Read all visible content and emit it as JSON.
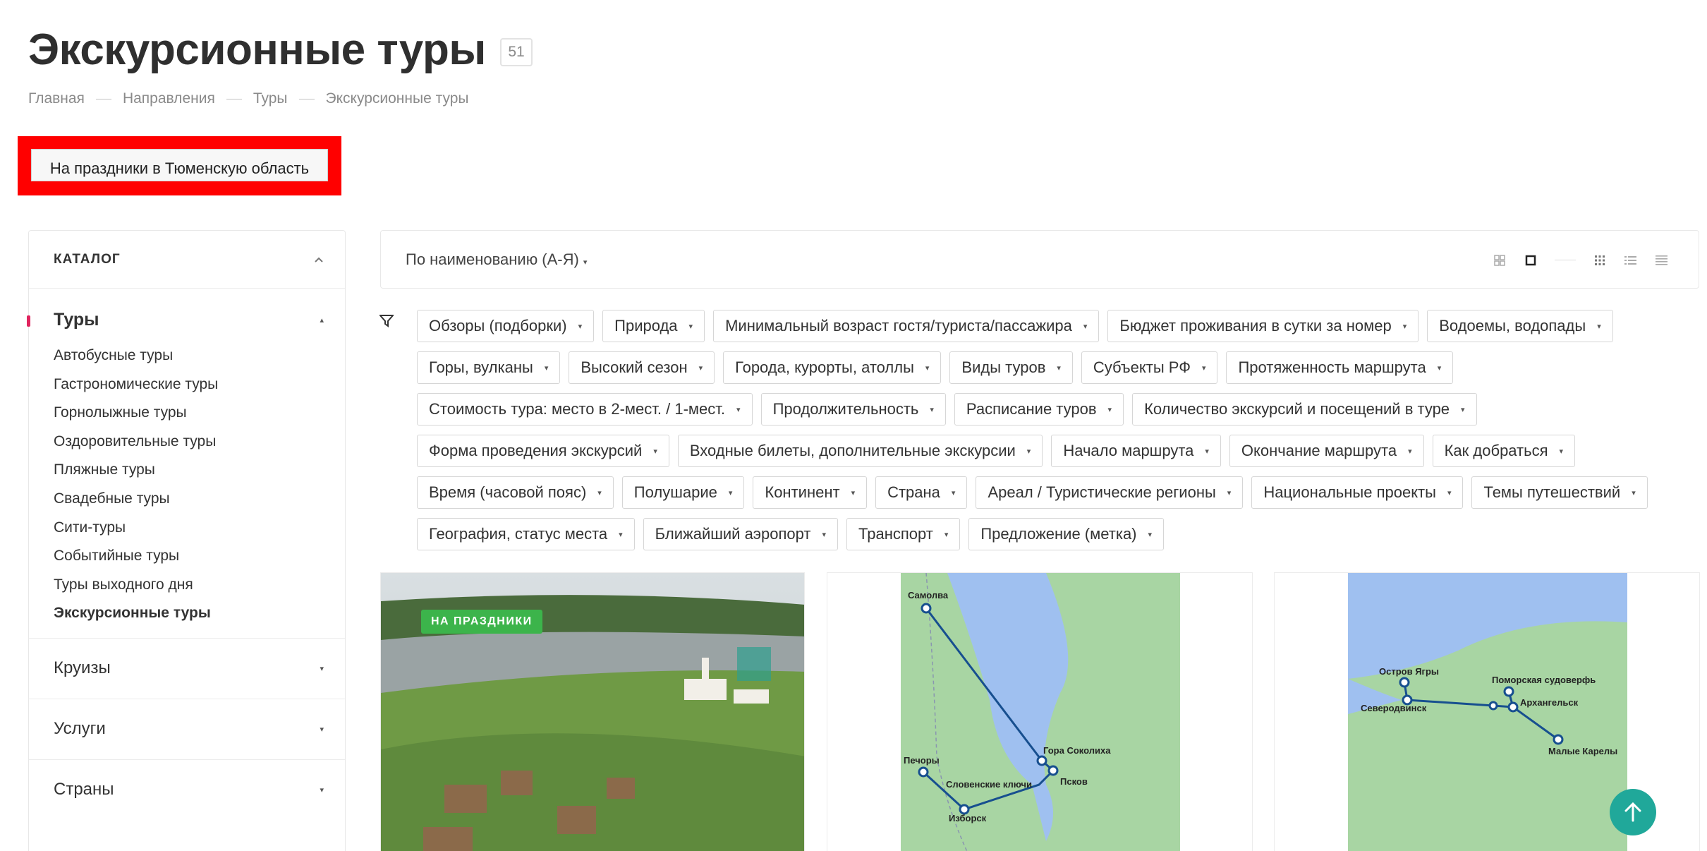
{
  "header": {
    "title": "Экскурсионные туры",
    "count": "51"
  },
  "breadcrumb": [
    "Главная",
    "Направления",
    "Туры",
    "Экскурсионные туры"
  ],
  "promo": {
    "label": "На праздники в Тюменскую область"
  },
  "sidebar": {
    "heading": "КАТАЛОГ",
    "active_section": "Туры",
    "sub_items": [
      "Автобусные туры",
      "Гастрономические туры",
      "Горнолыжные туры",
      "Оздоровительные туры",
      "Пляжные туры",
      "Свадебные туры",
      "Сити-туры",
      "Событийные туры",
      "Туры выходного дня",
      "Экскурсионные туры"
    ],
    "sections": [
      "Круизы",
      "Услуги",
      "Страны"
    ]
  },
  "sort": {
    "label": "По наименованию (А-Я)"
  },
  "filters": [
    "Обзоры (подборки)",
    "Природа",
    "Минимальный возраст гостя/туриста/пассажира",
    "Бюджет проживания в сутки за номер",
    "Водоемы, водопады",
    "Горы, вулканы",
    "Высокий сезон",
    "Города, курорты, атоллы",
    "Виды туров",
    "Субъекты РФ",
    "Протяженность маршрута",
    "Стоимость тура: место в 2-мест. / 1-мест.",
    "Продолжительность",
    "Расписание туров",
    "Количество экскурсий и посещений в туре",
    "Форма проведения экскурсий",
    "Входные билеты, дополнительные экскурсии",
    "Начало маршрута",
    "Окончание маршрута",
    "Как добраться",
    "Время (часовой пояс)",
    "Полушарие",
    "Континент",
    "Страна",
    "Ареал / Туристические регионы",
    "Национальные проекты",
    "Темы путешествий",
    "География, статус места",
    "Ближайший аэропорт",
    "Транспорт",
    "Предложение (метка)"
  ],
  "cards": {
    "card1": {
      "tag": "НА ПРАЗДНИКИ"
    },
    "map1": {
      "labels": [
        "Самолва",
        "Гора Соколиха",
        "Печоры",
        "Словенские ключи",
        "Псков",
        "Изборск"
      ]
    },
    "map2": {
      "labels": [
        "Остров Ягры",
        "Поморская судоверфь",
        "Северодвинск",
        "Архангельск",
        "Малые Карелы"
      ]
    }
  },
  "colors": {
    "accent": "#e0245e",
    "tag_green": "#3cb44b",
    "totop": "#20a89a",
    "promo_border": "#ff0000"
  }
}
